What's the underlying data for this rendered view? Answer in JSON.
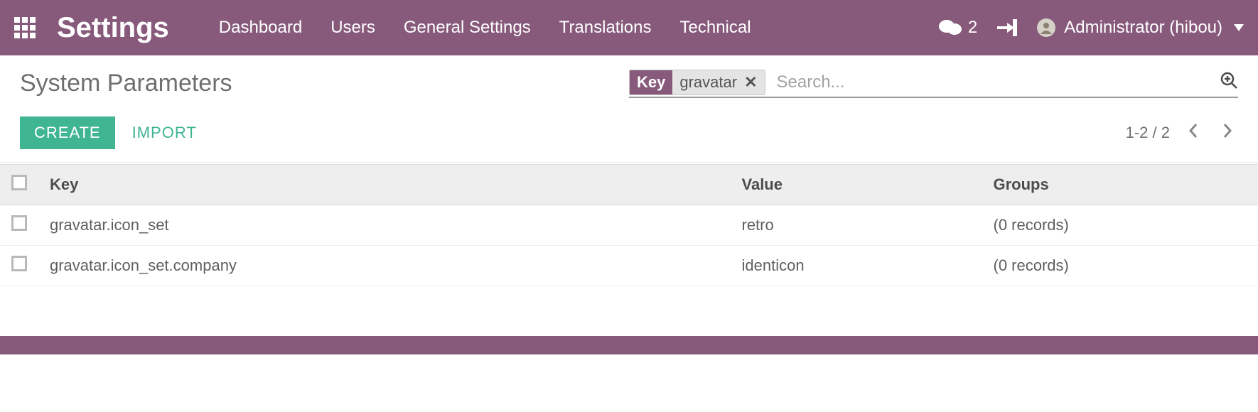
{
  "navbar": {
    "brand": "Settings",
    "links": [
      "Dashboard",
      "Users",
      "General Settings",
      "Translations",
      "Technical"
    ],
    "message_count": "2",
    "user_label": "Administrator (hibou)"
  },
  "breadcrumb": {
    "title": "System Parameters"
  },
  "search": {
    "facet_label": "Key",
    "facet_value": "gravatar",
    "placeholder": "Search..."
  },
  "buttons": {
    "create": "CREATE",
    "import": "IMPORT"
  },
  "pager": {
    "range": "1-2 / 2"
  },
  "table": {
    "headers": {
      "key": "Key",
      "value": "Value",
      "groups": "Groups"
    },
    "rows": [
      {
        "key": "gravatar.icon_set",
        "value": "retro",
        "groups": "(0 records)"
      },
      {
        "key": "gravatar.icon_set.company",
        "value": "identicon",
        "groups": "(0 records)"
      }
    ]
  }
}
